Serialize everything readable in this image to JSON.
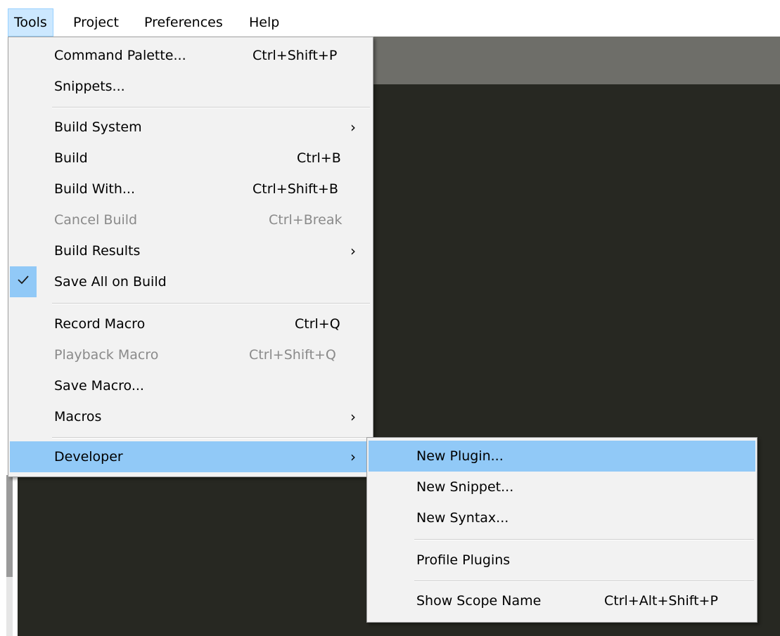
{
  "menubar": {
    "items": [
      {
        "label": "Tools",
        "active": true
      },
      {
        "label": "Project",
        "active": false
      },
      {
        "label": "Preferences",
        "active": false
      },
      {
        "label": "Help",
        "active": false
      }
    ]
  },
  "tools_menu": {
    "items": [
      {
        "label": "Command Palette...",
        "shortcut": "Ctrl+Shift+P",
        "enabled": true
      },
      {
        "label": "Snippets...",
        "shortcut": "",
        "enabled": true
      },
      {
        "label": "Build System",
        "shortcut": "",
        "submenu": true,
        "enabled": true
      },
      {
        "label": "Build",
        "shortcut": "Ctrl+B",
        "enabled": true
      },
      {
        "label": "Build With...",
        "shortcut": "Ctrl+Shift+B",
        "enabled": true
      },
      {
        "label": "Cancel Build",
        "shortcut": "Ctrl+Break",
        "enabled": false
      },
      {
        "label": "Build Results",
        "shortcut": "",
        "submenu": true,
        "enabled": true
      },
      {
        "label": "Save All on Build",
        "shortcut": "",
        "checked": true,
        "enabled": true
      },
      {
        "label": "Record Macro",
        "shortcut": "Ctrl+Q",
        "enabled": true
      },
      {
        "label": "Playback Macro",
        "shortcut": "Ctrl+Shift+Q",
        "enabled": false
      },
      {
        "label": "Save Macro...",
        "shortcut": "",
        "enabled": true
      },
      {
        "label": "Macros",
        "shortcut": "",
        "submenu": true,
        "enabled": true
      },
      {
        "label": "Developer",
        "shortcut": "",
        "submenu": true,
        "enabled": true,
        "highlighted": true
      }
    ]
  },
  "developer_menu": {
    "items": [
      {
        "label": "New Plugin...",
        "shortcut": "",
        "highlighted": true
      },
      {
        "label": "New Snippet...",
        "shortcut": ""
      },
      {
        "label": "New Syntax...",
        "shortcut": ""
      },
      {
        "label": "Profile Plugins",
        "shortcut": ""
      },
      {
        "label": "Show Scope Name",
        "shortcut": "Ctrl+Alt+Shift+P"
      }
    ]
  },
  "icons": {
    "submenu_arrow": "chevron-right-icon",
    "check": "checkmark-icon"
  },
  "colors": {
    "highlight": "#91c9f7",
    "menu_bg": "#f2f2f2",
    "editor_bg": "#272822",
    "tabbar_bg": "#6e6e69",
    "menubar_active": "#cce8ff",
    "disabled_text": "#8a8a8a"
  }
}
